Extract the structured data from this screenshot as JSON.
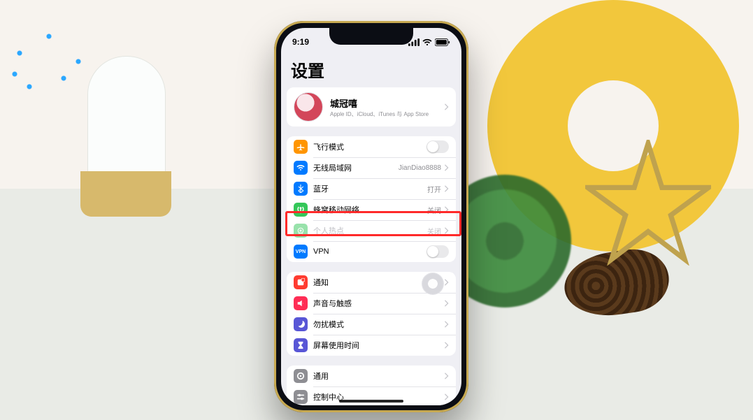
{
  "statusbar": {
    "time": "9:19"
  },
  "page": {
    "title": "设置"
  },
  "profile": {
    "name": "城冠嘻",
    "sub": "Apple ID、iCloud、iTunes 与 App Store"
  },
  "group1": {
    "airplane": {
      "label": "飞行模式"
    },
    "wifi": {
      "label": "无线局域网",
      "detail": "JianDiao8888"
    },
    "bluetooth": {
      "label": "蓝牙",
      "detail": "打开"
    },
    "cellular": {
      "label": "蜂窝移动网络",
      "detail": "关闭"
    },
    "hotspot": {
      "label": "个人热点",
      "detail": "关闭"
    },
    "vpn": {
      "label": "VPN"
    }
  },
  "group2": {
    "notifications": {
      "label": "通知"
    },
    "sounds": {
      "label": "声音与触感"
    },
    "dnd": {
      "label": "勿扰模式"
    },
    "screentime": {
      "label": "屏幕使用时间"
    }
  },
  "group3": {
    "general": {
      "label": "通用"
    },
    "controlcenter": {
      "label": "控制中心"
    }
  },
  "highlight": "cellular",
  "colors": {
    "airplane": "#ff9500",
    "wifi": "#007aff",
    "bluetooth": "#007aff",
    "cellular": "#34c759",
    "hotspot": "#34c759",
    "vpn": "#007aff",
    "notifications": "#ff3b30",
    "sounds": "#ff2d55",
    "dnd": "#5856d6",
    "screentime": "#5856d6",
    "general": "#8e8e93",
    "controlcenter": "#8e8e93"
  }
}
